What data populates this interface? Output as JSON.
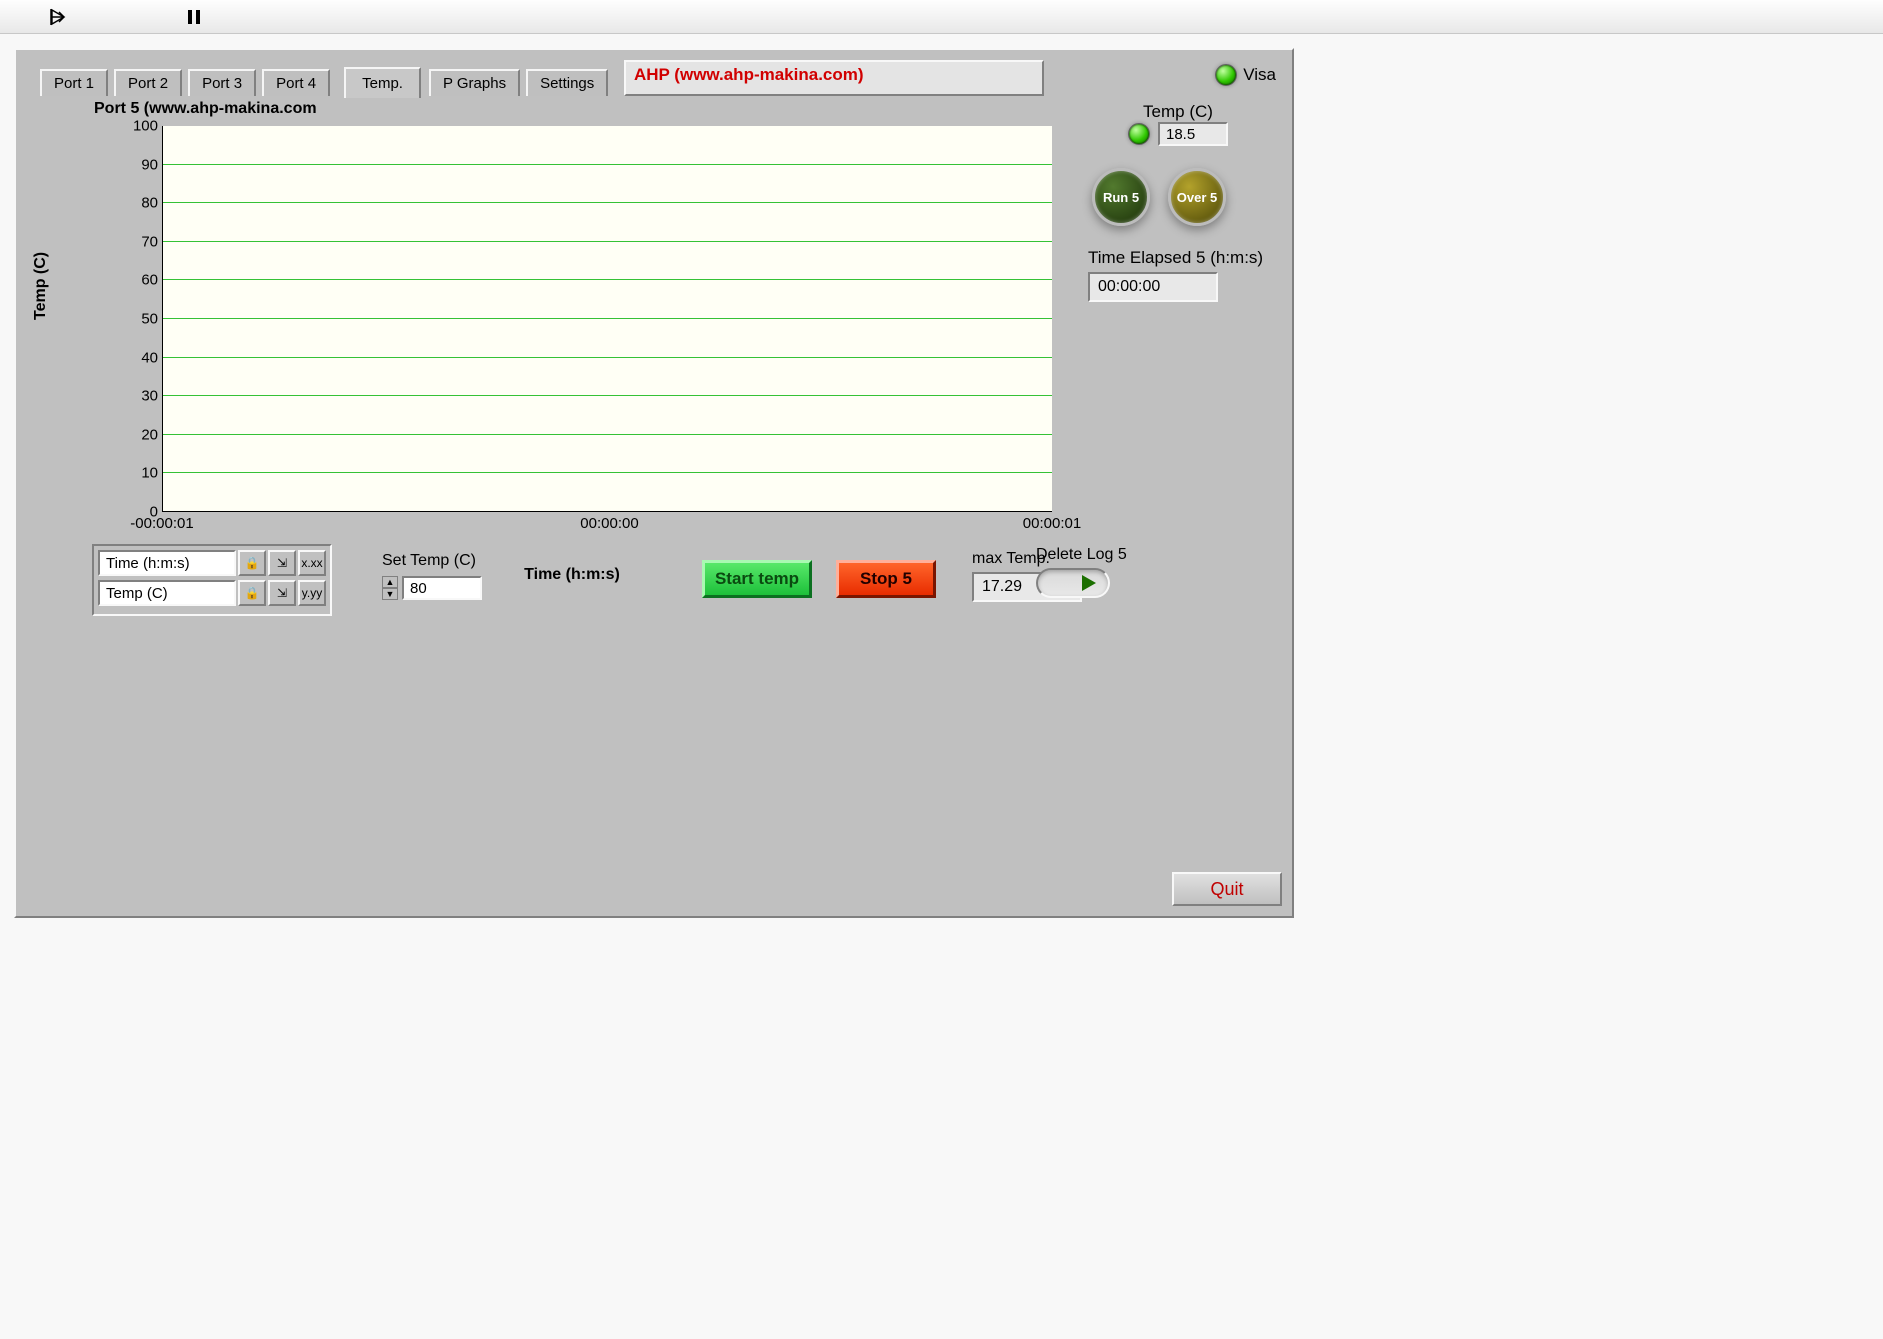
{
  "toolbar": {
    "run_icon": "run-arrow",
    "pause_icon": "pause"
  },
  "title_banner": "AHP (www.ahp-makina.com)",
  "visa_label": "Visa",
  "tabs": {
    "items": [
      "Port 1",
      "Port 2",
      "Port 3",
      "Port 4",
      "Temp.",
      "P Graphs",
      "Settings"
    ],
    "active_index": 4
  },
  "chart_title": "Port 5  (www.ahp-makina.com",
  "chart_data": {
    "type": "line",
    "x": [],
    "series": [
      {
        "name": "Temp (C)",
        "values": []
      }
    ],
    "title": "Port 5  (www.ahp-makina.com",
    "xlabel": "Time (h:m:s)",
    "ylabel": "Temp (C)",
    "ylim": [
      0,
      100
    ],
    "yticks": [
      0,
      10,
      20,
      30,
      40,
      50,
      60,
      70,
      80,
      90,
      100
    ],
    "xticks": [
      "-00:00:01",
      "00:00:00",
      "00:00:01"
    ],
    "grid": true,
    "legend": false
  },
  "axis_palette": {
    "x_name": "Time (h:m:s)",
    "y_name": "Temp (C)",
    "btn_lock": "🔒",
    "btn_autoscale_x": "⇲",
    "btn_format_x": "x.xx",
    "btn_autoscale_y": "⇲",
    "btn_format_y": "y.yy"
  },
  "set_temp": {
    "label": "Set Temp (C)",
    "value": "80"
  },
  "start_button": "Start temp",
  "stop_button": "Stop 5",
  "max_temp": {
    "label": "max Temp.",
    "value": "17.29"
  },
  "right_panel": {
    "temp_label": "Temp (C)",
    "temp_value": "18.5",
    "run_label": "Run 5",
    "over_label": "Over 5",
    "elapsed_label": "Time Elapsed 5 (h:m:s)",
    "elapsed_value": "00:00:00"
  },
  "delete_log_label": "Delete Log 5",
  "quit_label": "Quit"
}
